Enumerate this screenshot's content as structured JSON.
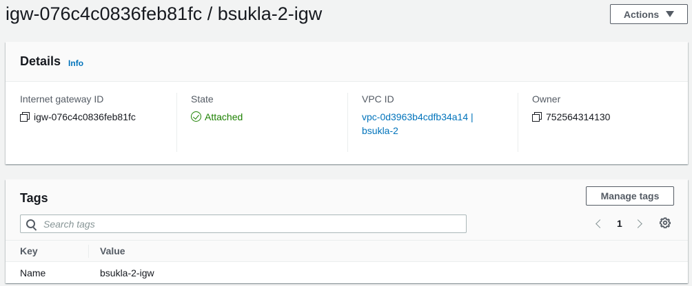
{
  "page": {
    "title": "igw-076c4c0836feb81fc / bsukla-2-igw",
    "actions_label": "Actions"
  },
  "details": {
    "title": "Details",
    "info_label": "Info",
    "fields": {
      "igw_id": {
        "label": "Internet gateway ID",
        "value": "igw-076c4c0836feb81fc"
      },
      "state": {
        "label": "State",
        "value": "Attached"
      },
      "vpc_id": {
        "label": "VPC ID",
        "value_line1": "vpc-0d3963b4cdfb34a14 |",
        "value_line2": "bsukla-2"
      },
      "owner": {
        "label": "Owner",
        "value": "752564314130"
      }
    }
  },
  "tags": {
    "title": "Tags",
    "manage_label": "Manage tags",
    "search_placeholder": "Search tags",
    "page_number": "1",
    "columns": [
      "Key",
      "Value"
    ],
    "rows": [
      {
        "key": "Name",
        "value": "bsukla-2-igw"
      }
    ]
  },
  "colors": {
    "link": "#0073bb",
    "success": "#1d8102",
    "border": "#eaeded",
    "background": "#f2f3f3"
  },
  "icons": [
    "caret-down-icon",
    "copy-icon",
    "check-circle-icon",
    "search-icon",
    "chevron-left-icon",
    "chevron-right-icon",
    "gear-icon"
  ]
}
